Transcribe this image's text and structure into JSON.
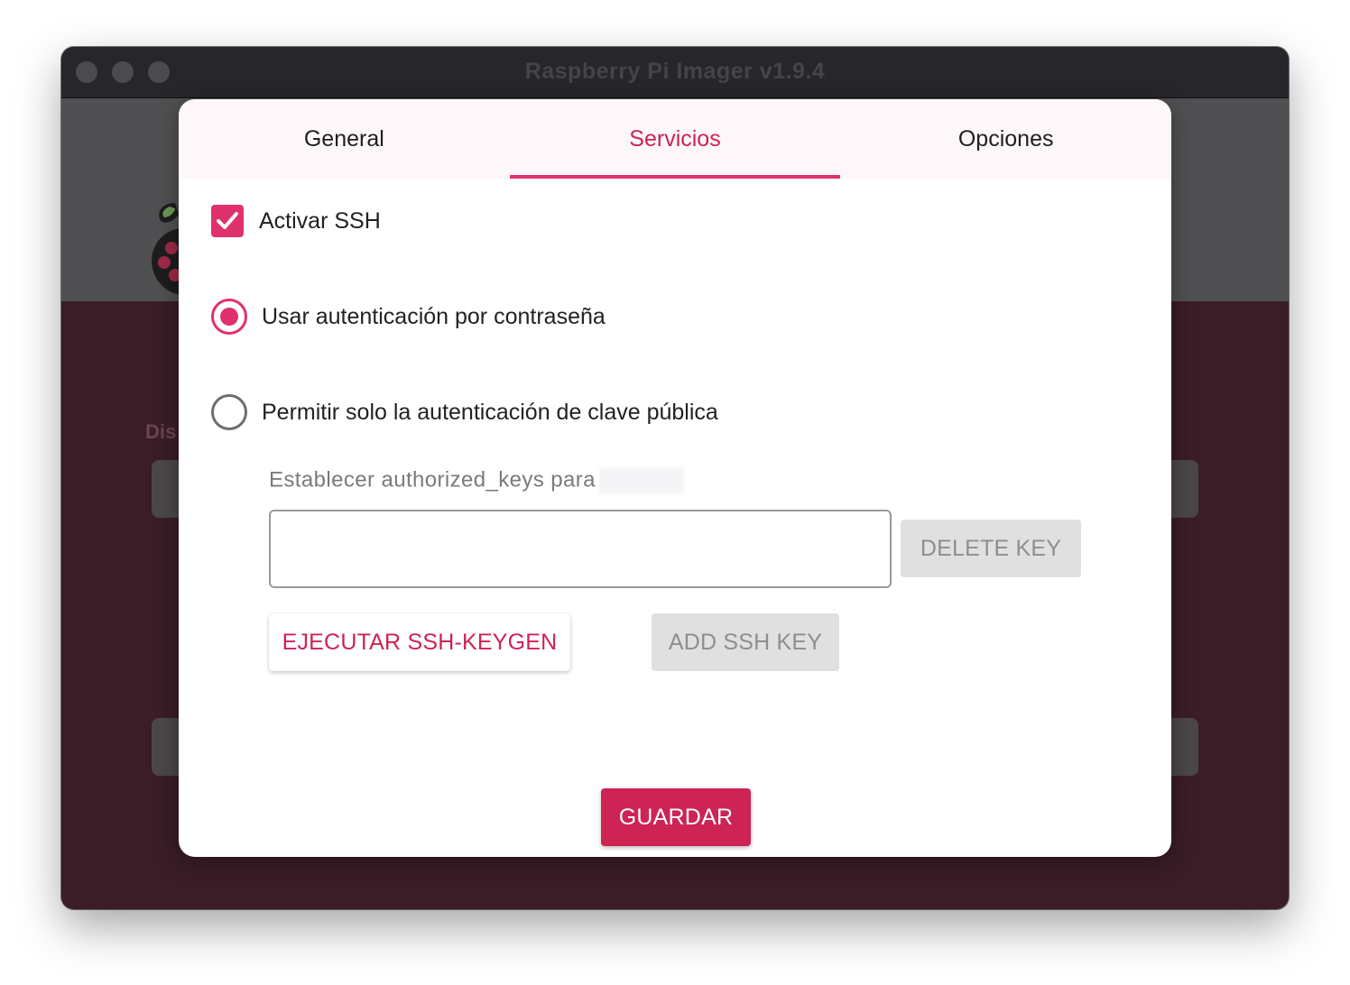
{
  "window": {
    "title": "Raspberry Pi Imager v1.9.4"
  },
  "background": {
    "partial_label": "Dis"
  },
  "tabs": [
    {
      "label": "General",
      "active": false
    },
    {
      "label": "Servicios",
      "active": true
    },
    {
      "label": "Opciones",
      "active": false
    }
  ],
  "ssh": {
    "enable_label": "Activar SSH",
    "enable_checked": true,
    "password_auth_label": "Usar autenticación por contraseña",
    "password_auth_selected": true,
    "pubkey_only_label": "Permitir solo la autenticación de clave pública",
    "pubkey_only_selected": false,
    "authorized_keys_label": "Establecer authorized_keys para",
    "authorized_keys_value": "",
    "delete_key_label": "DELETE KEY",
    "keygen_label": "EJECUTAR SSH-KEYGEN",
    "add_key_label": "ADD SSH KEY"
  },
  "footer": {
    "save_label": "GUARDAR"
  },
  "colors": {
    "accent": "#cd2355",
    "accent_light": "#e0326a",
    "tabbar_bg": "#fdf7fa",
    "disabled_bg": "#e0e0e0",
    "app_bg": "#3a1d26"
  },
  "icons": {
    "checkbox": "check-icon",
    "logo": "raspberry-logo-icon"
  }
}
